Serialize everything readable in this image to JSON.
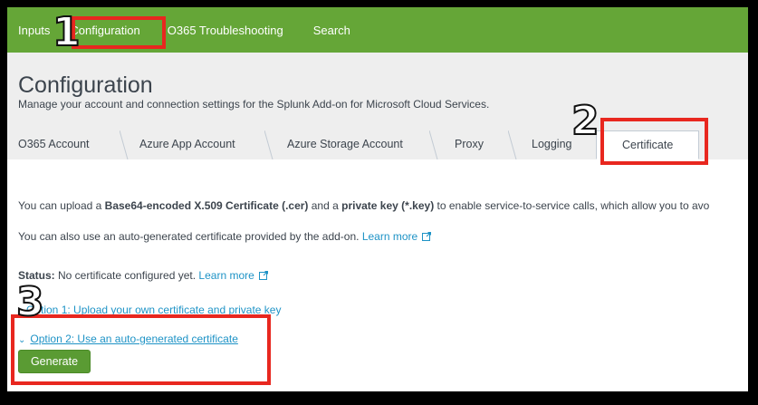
{
  "topnav": {
    "items": [
      "Inputs",
      "Configuration",
      "O365 Troubleshooting",
      "Search"
    ]
  },
  "header": {
    "title": "Configuration",
    "subtitle": "Manage your account and connection settings for the Splunk Add-on for Microsoft Cloud Services."
  },
  "tabs": [
    "O365 Account",
    "Azure App Account",
    "Azure Storage Account",
    "Proxy",
    "Logging",
    "Certificate"
  ],
  "active_tab": "Certificate",
  "content": {
    "upload_prefix": "You can upload a ",
    "upload_bold1": "Base64-encoded X.509 Certificate (.cer)",
    "upload_mid": " and a ",
    "upload_bold2": "private key (*.key)",
    "upload_suffix": " to enable service-to-service calls, which allow you to avo",
    "auto_text": "You can also use an auto-generated certificate provided by the add-on. ",
    "learn_more": "Learn more",
    "status_label": "Status:",
    "status_text": " No certificate configured yet.  ",
    "option1": "Option 1: Upload your own certificate and private key",
    "option2": "Option 2: Use an auto-generated certificate",
    "generate_label": "Generate"
  },
  "callouts": [
    "1",
    "2",
    "3"
  ],
  "colors": {
    "nav_green": "#65a637",
    "link_blue": "#1e93c6",
    "callout_red": "#e8271f",
    "button_green": "#5a9b33"
  }
}
